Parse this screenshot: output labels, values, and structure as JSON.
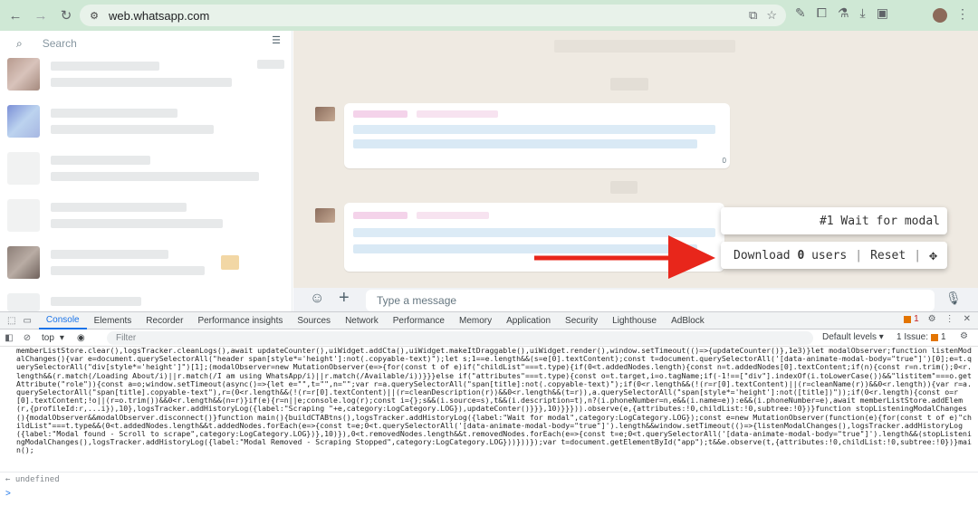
{
  "browser": {
    "url": "web.whatsapp.com"
  },
  "whatsapp": {
    "search_placeholder": "Search",
    "composer_placeholder": "Type a message",
    "bubble_time": "0"
  },
  "widget": {
    "status": "#1 Wait for modal",
    "download_prefix": "Download",
    "download_count": "0",
    "download_suffix": "users",
    "reset_label": "Reset",
    "drag_icon": "move-icon"
  },
  "devtools": {
    "tabs": [
      "Console",
      "Elements",
      "Recorder",
      "Performance insights",
      "Sources",
      "Network",
      "Performance",
      "Memory",
      "Application",
      "Security",
      "Lighthouse",
      "AdBlock"
    ],
    "active_tab": "Console",
    "issue_badge": "1",
    "context": "top",
    "filter_placeholder": "Filter",
    "levels": "Default levels",
    "issues_text": "1 Issue:",
    "issues_count": "1",
    "console_code": "memberListStore.clear(),logsTracker.cleanLogs(),await updateCounter(),uiWidget.addCta(),uiWidget.makeItDraggable(),uiWidget.render(),window.setTimeout(()=>{updateCounter()},1e3)}let modalObserver;function listenModalChanges(){var e=document.querySelectorAll(\"header span[style*='height']:not(.copyable-text)\");let s;1==e.length&&(s=e[0].textContent);const t=document.querySelectorAll('[data-animate-modal-body=\"true\"]')[0];e=t.querySelectorAll(\"div[style*='height']\")[1];(modalObserver=new MutationObserver(e=>{for(const t of e)if(\"childList\"===t.type){if(0<t.addedNodes.length){const n=t.addedNodes[0].textContent;if(n){const r=n.trim();0<r.length&&(r.match(/Loading About/i)||r.match(/I am using WhatsApp/i)||r.match(/Available/i))}}}else if(\"attributes\"===t.type){const o=t.target,i=o.tagName;if(-1!==[\"div\"].indexOf(i.toLowerCase())&&\"listitem\"===o.getAttribute(\"role\")){const a=o;window.setTimeout(async()=>{let e=\"\",t=\"\",n=\"\";var r=a.querySelectorAll(\"span[title]:not(.copyable-text)\");if(0<r.length&&(!(r=r[0].textContent)||(r=cleanName(r))&&0<r.length)){var r=a.querySelectorAll(\"span[title].copyable-text\"),r=(0<r.length&&(!(r=r[0].textContent)||(r=cleanDescription(r))&&0<r.length&&(t=r)),a.querySelectorAll(\"span[style*='height']:not([title])\"));if(0<r.length){const o=r[0].textContent;!o||(r=o.trim())&&0<r.length&&(n=r)}if(e){r=n||e;console.log(r);const i={};s&&(i.source=s),t&&(i.description=t),n?(i.phoneNumber=n,e&&(i.name=e)):e&&(i.phoneNumber=e),await memberListStore.addElem(r,{profileId:r,...i}),10},logsTracker.addHistoryLog({label:\"Scraping \"+e,category:LogCategory.LOG}),updateConter()}}},10)}}})).observe(e,{attributes:!0,childList:!0,subtree:!0})}function stopListeningModalChanges(){modalObserver&&modalObserver.disconnect()}function main(){buildCTABtns(),logsTracker.addHistoryLog({label:\"Wait for modal\",category:LogCategory.LOG});const e=new MutationObserver(function(e){for(const t of e)\"childList\"===t.type&&(0<t.addedNodes.length&&t.addedNodes.forEach(e=>{const t=e;0<t.querySelectorAll('[data-animate-modal-body=\"true\"]').length&&window.setTimeout(()=>{listenModalChanges(),logsTracker.addHistoryLog({label:\"Modal found - Scroll to scrape\",category:LogCategory.LOG})},10)}),0<t.removedNodes.length&&t.removedNodes.forEach(e=>{const t=e;0<t.querySelectorAll('[data-animate-modal-body=\"true\"]').length&&(stopListeningModalChanges(),logsTracker.addHistoryLog({label:\"Modal Removed - Scraping Stopped\",category:LogCategory.LOG}))}))});var t=document.getElementById(\"app\");t&&e.observe(t,{attributes:!0,childList:!0,subtree:!0})}main();",
    "result": "undefined",
    "prompt": ">"
  }
}
